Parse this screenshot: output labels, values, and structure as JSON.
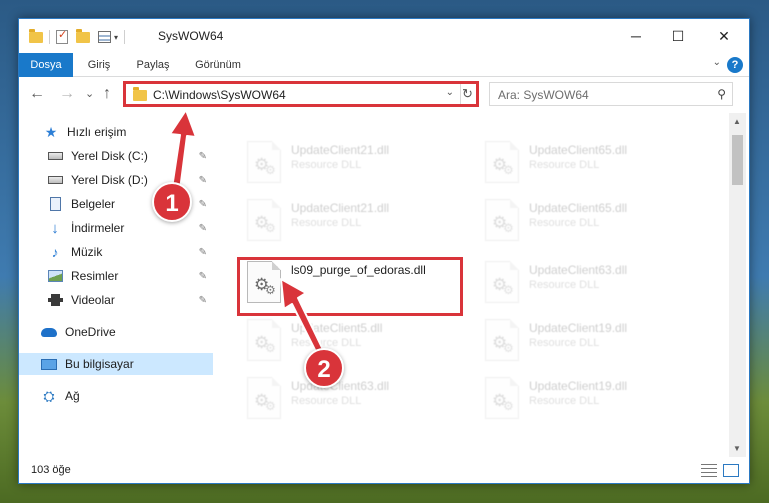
{
  "window": {
    "title": "SysWOW64",
    "minimize_glyph": "─",
    "maximize_glyph": "☐",
    "close_glyph": "✕"
  },
  "ribbon": {
    "tabs": [
      {
        "label": "Dosya"
      },
      {
        "label": "Giriş"
      },
      {
        "label": "Paylaş"
      },
      {
        "label": "Görünüm"
      }
    ],
    "help_glyph": "?",
    "collapse_glyph": "⌄"
  },
  "navigation": {
    "back_glyph": "←",
    "forward_glyph": "→",
    "recent_glyph": "⌄",
    "up_glyph": "↑",
    "address_path": "C:\\Windows\\SysWOW64",
    "address_dropdown_glyph": "⌄",
    "refresh_glyph": "↻",
    "search_placeholder": "Ara: SysWOW64",
    "search_glyph": "⚲"
  },
  "sidebar": {
    "items": [
      {
        "label": "Hızlı erişim",
        "icon": "star-icon",
        "pinned": false
      },
      {
        "label": "Yerel Disk (C:)",
        "icon": "drive-icon",
        "pinned": true
      },
      {
        "label": "Yerel Disk (D:)",
        "icon": "drive-icon",
        "pinned": true
      },
      {
        "label": "Belgeler",
        "icon": "documents-icon",
        "pinned": true
      },
      {
        "label": "İndirmeler",
        "icon": "downloads-icon",
        "pinned": true
      },
      {
        "label": "Müzik",
        "icon": "music-icon",
        "pinned": true
      },
      {
        "label": "Resimler",
        "icon": "pictures-icon",
        "pinned": true
      },
      {
        "label": "Videolar",
        "icon": "videos-icon",
        "pinned": true
      },
      {
        "label": "OneDrive",
        "icon": "onedrive-icon",
        "pinned": false
      },
      {
        "label": "Bu bilgisayar",
        "icon": "this-pc-icon",
        "pinned": false,
        "selected": true
      },
      {
        "label": "Ağ",
        "icon": "network-icon",
        "pinned": false
      }
    ],
    "pin_glyph": "📌"
  },
  "files": {
    "left_column": [
      {
        "name": "UpdateClient21.dll",
        "type": "Resource DLL"
      },
      {
        "name": "UpdateClient21.dll",
        "type": "Resource DLL"
      },
      {
        "name": "ls09_purge_of_edoras.dll",
        "type": ""
      },
      {
        "name": "UpdateClient5.dll",
        "type": "Resource DLL"
      },
      {
        "name": "UpdateClient63.dll",
        "type": "Resource DLL"
      }
    ],
    "right_column": [
      {
        "name": "UpdateClient65.dll",
        "type": "Resource DLL"
      },
      {
        "name": "UpdateClient65.dll",
        "type": "Resource DLL"
      },
      {
        "name": "UpdateClient63.dll",
        "type": "Resource DLL"
      },
      {
        "name": "UpdateClient19.dll",
        "type": "Resource DLL"
      },
      {
        "name": "UpdateClient19.dll",
        "type": "Resource DLL"
      }
    ]
  },
  "status": {
    "item_count": "103 öğe"
  },
  "annotations": {
    "badge_1": "1",
    "badge_2": "2",
    "color": "#d9343a"
  },
  "colors": {
    "accent": "#1979ca",
    "selected_bg": "#cce8ff",
    "highlight_red": "#d9343a"
  }
}
